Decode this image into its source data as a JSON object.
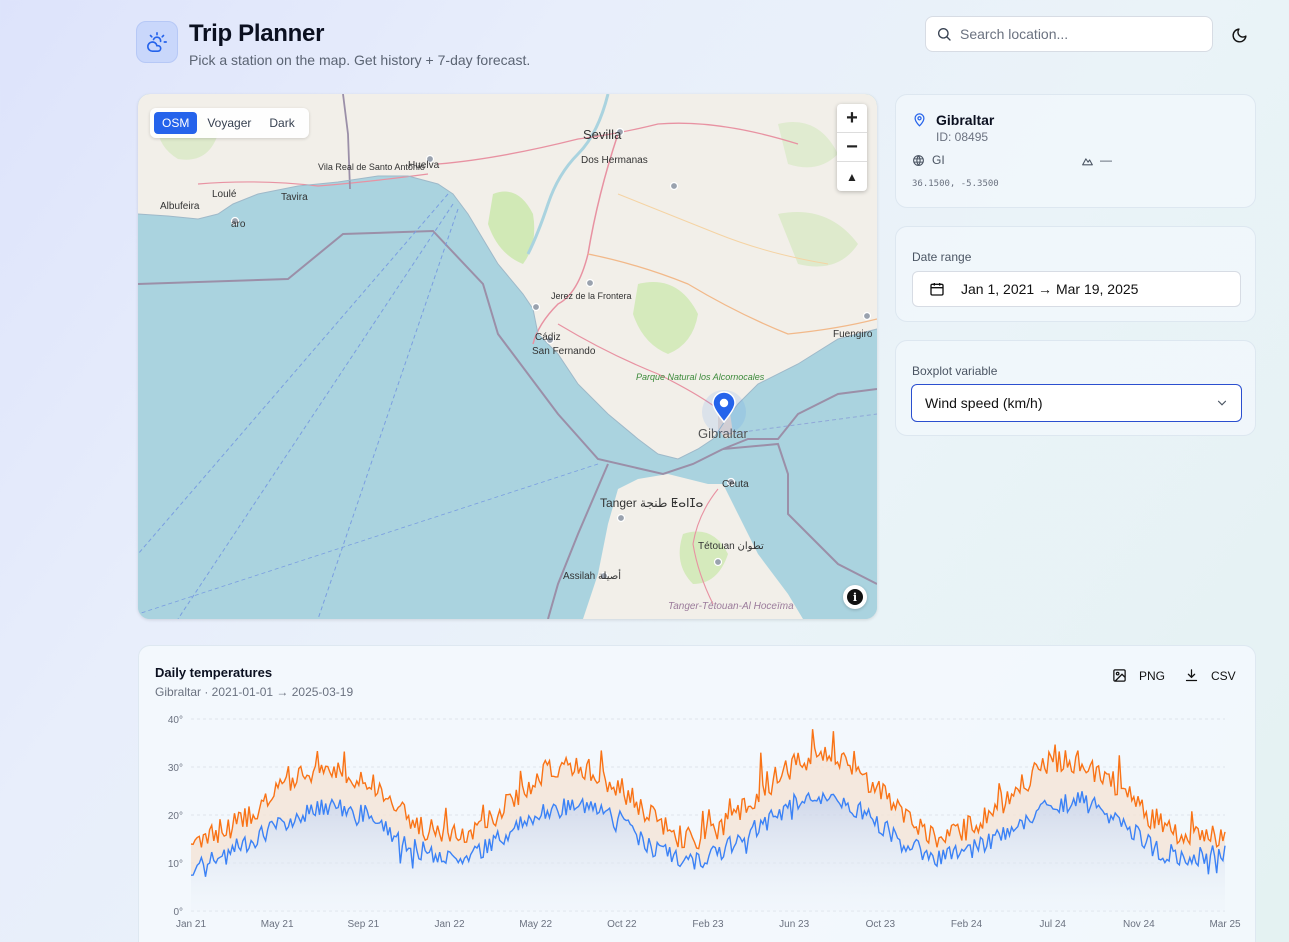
{
  "app": {
    "title": "Trip Planner",
    "subtitle": "Pick a station on the map. Get history + 7-day forecast.",
    "logo_icon": "sun-cloud-icon"
  },
  "search": {
    "placeholder": "Search location..."
  },
  "theme_toggle": {
    "icon": "moon-icon"
  },
  "map": {
    "layers": [
      "OSM",
      "Voyager",
      "Dark"
    ],
    "active_layer": "OSM",
    "zoom_in": "+",
    "zoom_out": "−",
    "compass": "▲",
    "info": "i",
    "place_labels": [
      "Sevilla",
      "Dos Hermanas",
      "Huelva",
      "Vila Real de Santo António",
      "Loulé",
      "Tavira",
      "Albufeira",
      "aro",
      "Jerez de la Frontera",
      "Cádiz",
      "San Fernando",
      "Parque Natural los Alcornocales",
      "Gibraltar",
      "Ceuta",
      "Tanger طنجة ⵟⴰⵏⵊⴰ",
      "Tétouan تطوان",
      "Assilah أصيلة",
      "Tanger-Tétouan-Al Hoceïma",
      "Fuengiro"
    ]
  },
  "station": {
    "name": "Gibraltar",
    "id_text": "ID: 08495",
    "country": "GI",
    "elevation": "—",
    "coords": "36.1500, -5.3500"
  },
  "date_range": {
    "label": "Date range",
    "value": "Jan 1, 2021 → Mar 19, 2025"
  },
  "boxplot": {
    "label": "Boxplot variable",
    "value": "Wind speed (km/h)"
  },
  "chart": {
    "png_label": "PNG",
    "csv_label": "CSV"
  },
  "colors": {
    "accent": "#2563eb",
    "tmax": "#f97316",
    "tmin": "#3b82f6",
    "sea": "#aad3df",
    "land": "#f2efe9"
  },
  "chart_data": {
    "type": "line",
    "title": "Daily temperatures",
    "subtitle": "Gibraltar · 2021-01-01 → 2025-03-19",
    "xlabel": "",
    "ylabel": "",
    "ylim": [
      0,
      40
    ],
    "y_ticks": [
      "0°",
      "10°",
      "20°",
      "30°",
      "40°"
    ],
    "x_ticks": [
      "Jan 21",
      "May 21",
      "Sep 21",
      "Jan 22",
      "May 22",
      "Oct 22",
      "Feb 23",
      "Jun 23",
      "Oct 23",
      "Feb 24",
      "Jul 24",
      "Nov 24",
      "Mar 25"
    ],
    "grid": true,
    "x_monthly": [
      "2021-01",
      "2021-03",
      "2021-05",
      "2021-07",
      "2021-08",
      "2021-09",
      "2021-11",
      "2022-01",
      "2022-03",
      "2022-05",
      "2022-07",
      "2022-08",
      "2022-09",
      "2022-11",
      "2023-01",
      "2023-03",
      "2023-05",
      "2023-07",
      "2023-08",
      "2023-09",
      "2023-11",
      "2024-01",
      "2024-03",
      "2024-05",
      "2024-07",
      "2024-08",
      "2024-09",
      "2024-11",
      "2025-01",
      "2025-03"
    ],
    "series": [
      {
        "values": [
          14,
          17,
          22,
          28,
          30,
          27,
          20,
          15,
          17,
          23,
          29,
          30,
          26,
          19,
          14,
          18,
          25,
          31,
          32,
          27,
          20,
          15,
          18,
          24,
          31,
          31,
          26,
          19,
          15,
          16
        ]
      },
      {
        "values": [
          9,
          12,
          16,
          20,
          22,
          20,
          14,
          11,
          12,
          17,
          21,
          22,
          19,
          13,
          10,
          13,
          18,
          23,
          24,
          20,
          14,
          11,
          13,
          17,
          22,
          23,
          19,
          13,
          11,
          12
        ]
      }
    ]
  }
}
